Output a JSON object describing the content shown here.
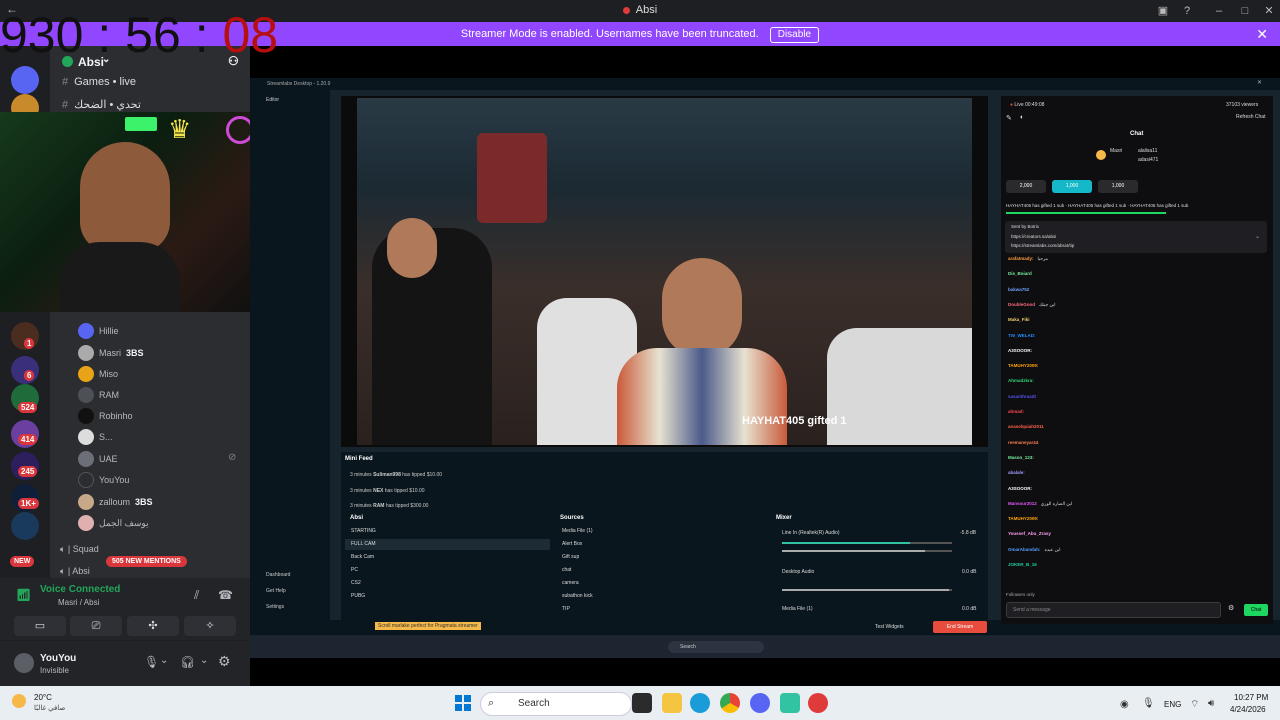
{
  "window": {
    "title": "Absi"
  },
  "banner": {
    "text": "Streamer Mode is enabled. Usernames have been truncated.",
    "button": "Disable"
  },
  "timer": {
    "hours": "930",
    "minutes": "56",
    "seconds": "08",
    "sep": ":"
  },
  "server": {
    "name": "Absi"
  },
  "channels": [
    {
      "name": "Games • live"
    },
    {
      "name": "تحدي • الضحك"
    }
  ],
  "guild_badges": [
    "1",
    "6",
    "524",
    "414",
    "245",
    "1K+"
  ],
  "new_label": "NEW",
  "mentions_label": "505 NEW MENTIONS",
  "members": [
    {
      "name": "Hillie",
      "tag": ""
    },
    {
      "name": "Masri",
      "tag": "3BS"
    },
    {
      "name": "Miso",
      "tag": ""
    },
    {
      "name": "RAM",
      "tag": ""
    },
    {
      "name": "Robinho",
      "tag": ""
    },
    {
      "name": "S...",
      "tag": ""
    },
    {
      "name": "UAE",
      "tag": ""
    },
    {
      "name": "YouYou",
      "tag": ""
    },
    {
      "name": "zalloum",
      "tag": "3BS"
    },
    {
      "name": "يوسف الجمل",
      "tag": ""
    }
  ],
  "voice_channels": [
    {
      "name": "| Squad"
    },
    {
      "name": "| Absi"
    }
  ],
  "voice": {
    "status": "Voice Connected",
    "location": "Masri / Absi"
  },
  "user": {
    "name": "YouYou",
    "status": "Invisible"
  },
  "streamlabs": {
    "title": "Streamlabs Desktop - 1.20.9",
    "editor": "Editor",
    "gifted_overlay": "HAYHAT405 gifted 1",
    "minifeed_title": "Mini Feed",
    "feed": [
      {
        "time": "3 minutes",
        "name": "Suliman998",
        "text": "has tipped $10.00"
      },
      {
        "time": "3 minutes",
        "name": "NEX",
        "text": "has tipped $10.00"
      },
      {
        "time": "3 minutes",
        "name": "RAM",
        "text": "has tipped $300.00"
      }
    ],
    "scenes_title": "Absi",
    "scenes": [
      "STARTING",
      "FULL CAM",
      "Back Cam",
      "PC",
      "CS2",
      "PUBG"
    ],
    "sources_title": "Sources",
    "sources": [
      "Media File (1)",
      "Alert Box",
      "Gift sup",
      "chat",
      "camera",
      "subathon kick",
      "TIP"
    ],
    "mixer_title": "Mixer",
    "mixer": [
      {
        "name": "Line In (Realtek(R) Audio)",
        "db": "-5.8 dB"
      },
      {
        "name": "Desktop Audio",
        "db": "0.0 dB"
      },
      {
        "name": "Media File (1)",
        "db": "0.0 dB"
      }
    ],
    "nav": [
      "Dashboard",
      "Get Help",
      "Settings"
    ],
    "account": "absi",
    "tip_banner": "Scroll marlake perfect for Pragmata streamer",
    "test_widgets": "Test Widgets",
    "end_stream": "End Stream"
  },
  "chat": {
    "live": "Live 00:49:08",
    "viewers": "37103 viewers",
    "refresh": "Refresh Chat",
    "title": "Chat",
    "top_users": [
      "Masri",
      "alalisa11",
      "adasi471"
    ],
    "pills": [
      "2,000",
      "1,000",
      "1,000"
    ],
    "gift_ticker": "HAYHAT405 has gifted 1 sub · HAYHAT405 has gifted 1 sub · HAYHAT405 has gifted 1 sub",
    "pinned_by": "Sent by Botrix",
    "pinned_link1": "https://creators.sa/absi",
    "pinned_link2": "https://streamlabs.com/absi4/tip",
    "messages": [
      {
        "name": "arafatmady:",
        "text": "مرحبا",
        "color": "#ff9f43"
      },
      {
        "name": "Dis_Boiard",
        "text": "",
        "color": "#7bed9f"
      },
      {
        "name": "bakwa752",
        "text": "",
        "color": "#70a1ff"
      },
      {
        "name": "DoubleGood",
        "text": "ابن جبتك",
        "color": "#ff6b81"
      },
      {
        "name": "Maka_Fiki",
        "text": "",
        "color": "#eccc68"
      },
      {
        "name": "TW_WELAD:",
        "text": "",
        "color": "#1e90ff"
      },
      {
        "name": "A3SOOOR:",
        "text": "",
        "color": "#ffffff"
      },
      {
        "name": "TAMUHY2009:",
        "text": "",
        "color": "#ffa502"
      },
      {
        "name": "Ahmadzkra:",
        "text": "",
        "color": "#2ed573"
      },
      {
        "name": "sasanthraadt",
        "text": "",
        "color": "#5352ed"
      },
      {
        "name": "ahmad:",
        "text": "",
        "color": "#ff4757"
      },
      {
        "name": "anaselquiah2011",
        "text": "",
        "color": "#ff6348"
      },
      {
        "name": "reemaneyar44",
        "text": "",
        "color": "#ff7f50"
      },
      {
        "name": "Mason_123:",
        "text": "",
        "color": "#7bed9f"
      },
      {
        "name": "abalale:",
        "text": "",
        "color": "#a29bfe"
      },
      {
        "name": "A3SOOOR:",
        "text": "",
        "color": "#ffffff"
      },
      {
        "name": "Mansour2012",
        "text": "ابن الصاره الوري",
        "color": "#e056fd"
      },
      {
        "name": "TAMUHY2009:",
        "text": "",
        "color": "#ffa502"
      },
      {
        "name": "Youssef_Abu_Zrasy",
        "text": "",
        "color": "#ff9ff3"
      },
      {
        "name": "OmarAbandah:",
        "text": "ابن عبده",
        "color": "#54a0ff"
      },
      {
        "name": "JOKER_B_16",
        "text": "",
        "color": "#1dd1a1"
      },
      {
        "name": "",
        "text": "",
        "color": "#ff6b6b"
      }
    ],
    "followers_only": "Followers only",
    "placeholder": "Send a message",
    "send": "Chat"
  },
  "taskbar": {
    "weather_temp": "20°C",
    "weather_desc": "صافي غالبًا",
    "search": "Search",
    "lang": "ENG",
    "time": "10:27 PM",
    "date": "4/24/2026"
  },
  "colors": {
    "twitch_purple": "#9146ff",
    "discord_bg": "#2b2d31",
    "streamlabs_bg": "#09161d",
    "kick_green": "#1ed760",
    "end_stream_red": "#e74c3c"
  }
}
